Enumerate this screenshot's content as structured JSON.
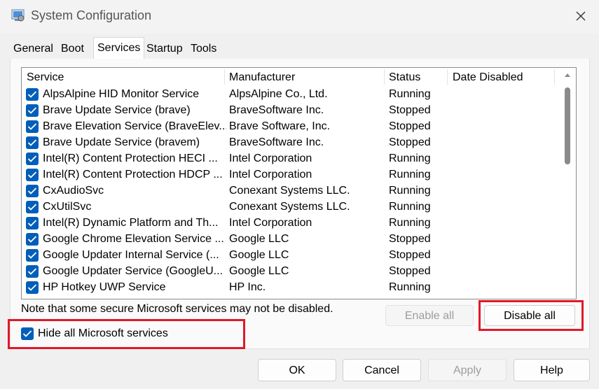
{
  "window": {
    "title": "System Configuration",
    "icon": "msconfig-icon",
    "close_icon": "close-icon"
  },
  "tabs": [
    {
      "label": "General",
      "active": false
    },
    {
      "label": "Boot",
      "active": false
    },
    {
      "label": "Services",
      "active": true
    },
    {
      "label": "Startup",
      "active": false
    },
    {
      "label": "Tools",
      "active": false
    }
  ],
  "columns": {
    "service": "Service",
    "manufacturer": "Manufacturer",
    "status": "Status",
    "date_disabled": "Date Disabled"
  },
  "rows": [
    {
      "checked": true,
      "service": "AlpsAlpine HID Monitor Service",
      "manufacturer": "AlpsAlpine Co., Ltd.",
      "status": "Running"
    },
    {
      "checked": true,
      "service": "Brave Update Service (brave)",
      "manufacturer": "BraveSoftware Inc.",
      "status": "Stopped"
    },
    {
      "checked": true,
      "service": "Brave Elevation Service (BraveElev...",
      "manufacturer": "Brave Software, Inc.",
      "status": "Stopped"
    },
    {
      "checked": true,
      "service": "Brave Update Service (bravem)",
      "manufacturer": "BraveSoftware Inc.",
      "status": "Stopped"
    },
    {
      "checked": true,
      "service": "Intel(R) Content Protection HECI ...",
      "manufacturer": "Intel Corporation",
      "status": "Running"
    },
    {
      "checked": true,
      "service": "Intel(R) Content Protection HDCP ...",
      "manufacturer": "Intel Corporation",
      "status": "Running"
    },
    {
      "checked": true,
      "service": "CxAudioSvc",
      "manufacturer": "Conexant Systems LLC.",
      "status": "Running"
    },
    {
      "checked": true,
      "service": "CxUtilSvc",
      "manufacturer": "Conexant Systems LLC.",
      "status": "Running"
    },
    {
      "checked": true,
      "service": "Intel(R) Dynamic Platform and Th...",
      "manufacturer": "Intel Corporation",
      "status": "Running"
    },
    {
      "checked": true,
      "service": "Google Chrome Elevation Service ...",
      "manufacturer": "Google LLC",
      "status": "Stopped"
    },
    {
      "checked": true,
      "service": "Google Updater Internal Service (...",
      "manufacturer": "Google LLC",
      "status": "Stopped"
    },
    {
      "checked": true,
      "service": "Google Updater Service (GoogleU...",
      "manufacturer": "Google LLC",
      "status": "Stopped"
    },
    {
      "checked": true,
      "service": "HP Hotkey UWP Service",
      "manufacturer": "HP Inc.",
      "status": "Running"
    }
  ],
  "note": "Note that some secure Microsoft services may not be disabled.",
  "enable_all": {
    "label": "Enable all",
    "disabled": true
  },
  "disable_all": {
    "label": "Disable all",
    "disabled": false
  },
  "hide_ms": {
    "label": "Hide all Microsoft services",
    "checked": true
  },
  "footer": {
    "ok": "OK",
    "cancel": "Cancel",
    "apply": "Apply",
    "help": "Help"
  },
  "colors": {
    "accent": "#005fb8",
    "highlight": "#e0192a"
  }
}
